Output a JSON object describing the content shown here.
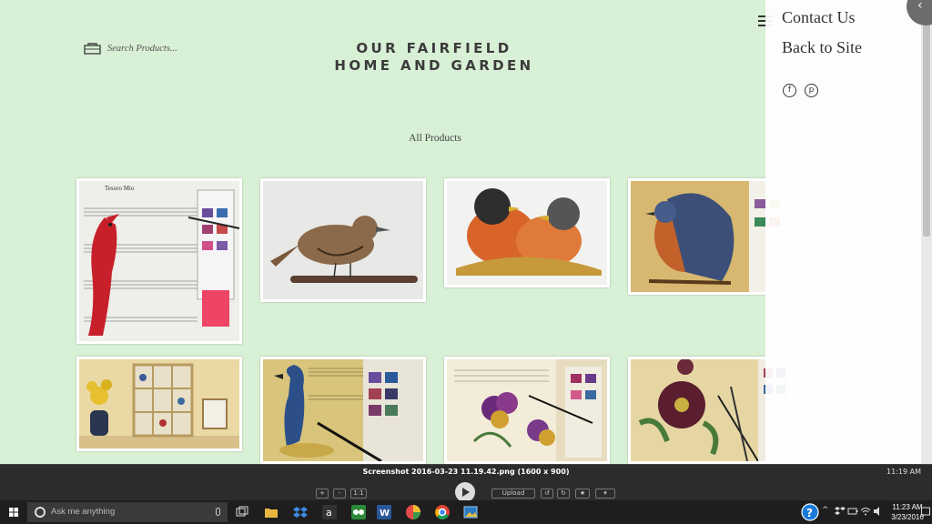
{
  "site": {
    "search_placeholder": "Search Products...",
    "title_line1": "OUR FAIRFIELD",
    "title_line2": "HOME AND GARDEN",
    "section_title": "All Products"
  },
  "panel": {
    "links": [
      "Contact Us",
      "Back to Site"
    ],
    "social": [
      "f",
      "p"
    ]
  },
  "products": [
    {
      "name": "cardinal-painting",
      "caption": "Tesoro Mio"
    },
    {
      "name": "wren-painting"
    },
    {
      "name": "robins-painting"
    },
    {
      "name": "bluebird-painting"
    },
    {
      "name": "window-frame-birds"
    },
    {
      "name": "blue-jay-painting"
    },
    {
      "name": "pansies-painting"
    },
    {
      "name": "hellebore-painting"
    }
  ],
  "viewer": {
    "title": "Screenshot 2016-03-23 11.19.42.png (1600 x 900)",
    "zoom_in": "+",
    "zoom_out": "-",
    "actual_size": "1:1",
    "upload": "Upload",
    "time": "11:19 AM"
  },
  "taskbar": {
    "search_placeholder": "Ask me anything",
    "time": "11:23 AM",
    "date": "3/23/2016"
  },
  "colors": {
    "background": "#d8f0d5",
    "panel": "#ffffff",
    "taskbar": "#1e1e1e",
    "accent": "#7fb2e0"
  }
}
